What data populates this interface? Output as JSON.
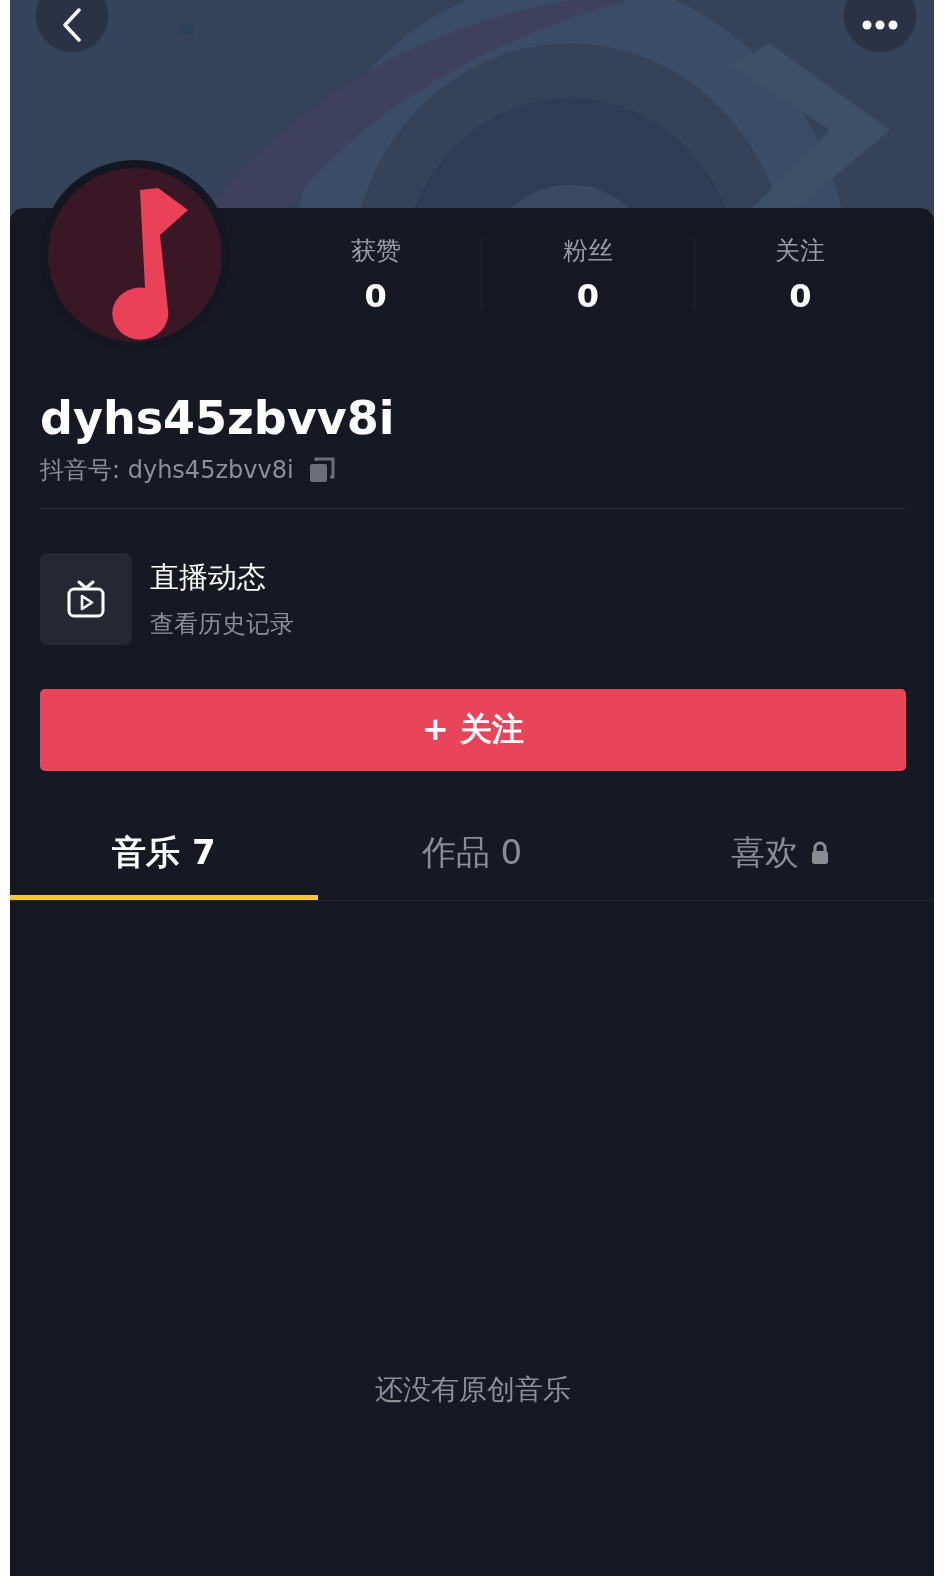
{
  "stats": [
    {
      "label": "获赞",
      "value": "0"
    },
    {
      "label": "粉丝",
      "value": "0"
    },
    {
      "label": "关注",
      "value": "0"
    }
  ],
  "profile": {
    "username": "dyhs45zbvv8i",
    "id_line": "抖音号: dyhs45zbvv8i"
  },
  "live": {
    "title": "直播动态",
    "subtitle": "查看历史记录"
  },
  "follow_button": "+ 关注",
  "tabs": [
    {
      "label": "音乐 7",
      "selected": true,
      "locked": false
    },
    {
      "label": "作品 0",
      "selected": false,
      "locked": false
    },
    {
      "label": "喜欢",
      "selected": false,
      "locked": true
    }
  ],
  "empty_message": "还没有原创音乐"
}
